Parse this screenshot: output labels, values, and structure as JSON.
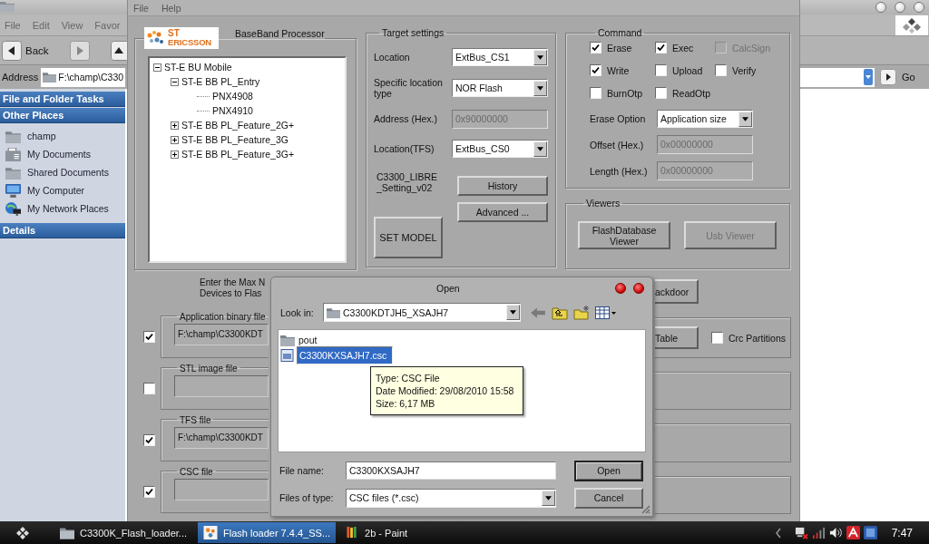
{
  "explorer": {
    "menu": [
      "File",
      "Edit",
      "View",
      "Favor"
    ],
    "back_button": "Back",
    "address": {
      "label": "Address",
      "value": "F:\\champ\\C330"
    },
    "go_button": "Go",
    "sidebar": [
      {
        "title": "File and Folder Tasks"
      },
      {
        "title": "Other Places",
        "items": [
          {
            "label": "champ",
            "kind": "folder"
          },
          {
            "label": "My Documents",
            "kind": "documents"
          },
          {
            "label": "Shared Documents",
            "kind": "folder"
          },
          {
            "label": "My Computer",
            "kind": "computer"
          },
          {
            "label": "My Network Places",
            "kind": "network"
          }
        ]
      },
      {
        "title": "Details"
      }
    ]
  },
  "flash_loader": {
    "menu": [
      "File",
      "Help"
    ],
    "baseband": {
      "logo": [
        "ST",
        "ERICSSON"
      ],
      "title": "BaseBand Processor",
      "tree": [
        {
          "label": "ST-E BU Mobile",
          "expanded": true,
          "children": [
            {
              "label": "ST-E BB PL_Entry",
              "expanded": true,
              "children": [
                {
                  "label": "PNX4908"
                },
                {
                  "label": "PNX4910"
                }
              ]
            },
            {
              "label": "ST-E BB PL_Feature_2G+",
              "expanded": false
            },
            {
              "label": "ST-E BB PL_Feature_3G",
              "expanded": false
            },
            {
              "label": "ST-E BB PL_Feature_3G+",
              "expanded": false
            }
          ]
        }
      ]
    },
    "target": {
      "title": "Target settings",
      "fields": [
        {
          "kind": "select",
          "label": "Location",
          "value": "ExtBus_CS1"
        },
        {
          "kind": "select",
          "label": "Specific location type",
          "value": "NOR Flash"
        },
        {
          "kind": "text",
          "label": "Address (Hex.)",
          "value": "0x90000000",
          "disabled": true
        },
        {
          "kind": "select",
          "label": "Location(TFS)",
          "value": "ExtBus_CS0"
        }
      ],
      "setting_name": [
        "C3300_LIBRE",
        "_Setting_v02"
      ],
      "history_button": "History",
      "advanced_button": "Advanced ...",
      "set_model_button": "SET MODEL"
    },
    "command": {
      "title": "Command",
      "options": [
        {
          "label": "Erase",
          "checked": true,
          "disabled": false
        },
        {
          "label": "Exec",
          "checked": true,
          "disabled": false
        },
        {
          "label": "CalcSign",
          "checked": false,
          "disabled": true
        },
        {
          "label": "Write",
          "checked": true,
          "disabled": false
        },
        {
          "label": "Upload",
          "checked": false,
          "disabled": false
        },
        {
          "label": "Verify",
          "checked": false,
          "disabled": false
        },
        {
          "label": "BurnOtp",
          "checked": false,
          "disabled": false
        },
        {
          "label": "ReadOtp",
          "checked": false,
          "disabled": false
        }
      ],
      "erase_option": {
        "label": "Erase Option",
        "value": "Application size"
      },
      "offset": {
        "label": "Offset (Hex.)",
        "value": "0x00000000",
        "disabled": true
      },
      "length": {
        "label": "Length (Hex.)",
        "value": "0x00000000",
        "disabled": true
      }
    },
    "viewers": {
      "title": "Viewers",
      "buttons": [
        {
          "label": "FlashDatabase Viewer",
          "disabled": false
        },
        {
          "label": "Usb Viewer",
          "disabled": true
        }
      ]
    },
    "max_devices_text": [
      "Enter the Max N",
      "Devices to Flas"
    ],
    "backdoor_button": "ackdoor",
    "files": [
      {
        "title": "Application binary file",
        "checked": true,
        "value": "F:\\champ\\C3300KDT"
      },
      {
        "title": "STL image file",
        "checked": false
      },
      {
        "title": "TFS file",
        "checked": true,
        "value": "F:\\champ\\C3300KDT"
      },
      {
        "title": "CSC file",
        "checked": true
      }
    ],
    "table_button": "Table",
    "crc_partitions": {
      "label": "Crc Partitions",
      "checked": false
    }
  },
  "open_dialog": {
    "title": "Open",
    "look_in": {
      "label": "Look in:",
      "value": "C3300KDTJH5_XSAJH7"
    },
    "files": [
      {
        "name": "pout",
        "kind": "folder",
        "selected": false
      },
      {
        "name": "C3300KXSAJH7.csc",
        "kind": "file",
        "selected": true
      }
    ],
    "tooltip": [
      "Type: CSC File",
      "Date Modified: 29/08/2010 15:58",
      "Size: 6,17 MB"
    ],
    "file_name": {
      "label": "File name:",
      "value": "C3300KXSAJH7"
    },
    "file_type": {
      "label": "Files of type:",
      "value": "CSC files (*.csc)"
    },
    "open_button": "Open",
    "cancel_button": "Cancel"
  },
  "taskbar": {
    "tasks": [
      {
        "label": "C3300K_Flash_loader...",
        "kind": "folder",
        "selected": false
      },
      {
        "label": "Flash loader 7.4.4_SS...",
        "kind": "app",
        "selected": true
      },
      {
        "label": "2b - Paint",
        "kind": "paint",
        "selected": false
      }
    ],
    "clock": "7:47"
  }
}
